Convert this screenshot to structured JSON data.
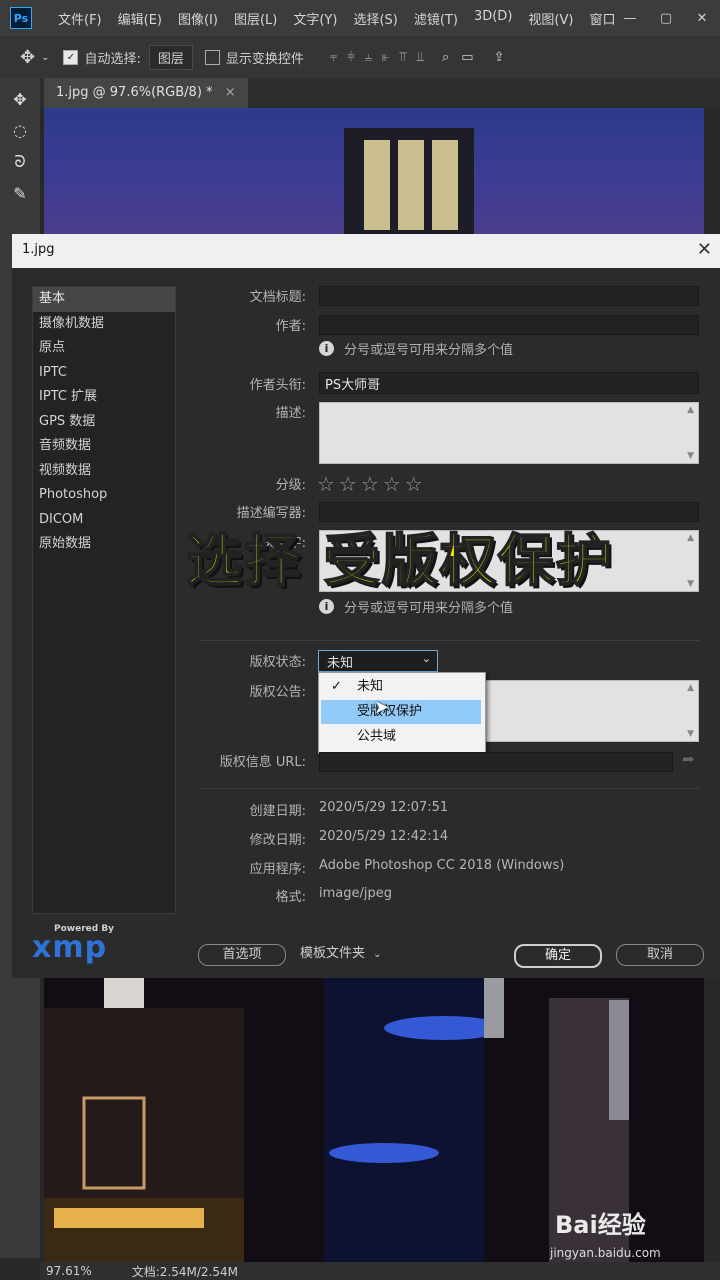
{
  "app": {
    "logo": "Ps"
  },
  "menubar": {
    "items": [
      "文件(F)",
      "编辑(E)",
      "图像(I)",
      "图层(L)",
      "文字(Y)",
      "选择(S)",
      "滤镜(T)",
      "3D(D)",
      "视图(V)",
      "窗口"
    ]
  },
  "optionsbar": {
    "auto_select_label": "自动选择:",
    "auto_select_value": "图层",
    "show_transform_label": "显示变换控件"
  },
  "document_tab": {
    "title": "1.jpg @ 97.6%(RGB/8) *"
  },
  "dialog": {
    "title": "1.jpg",
    "categories": [
      "基本",
      "摄像机数据",
      "原点",
      "IPTC",
      "IPTC 扩展",
      "GPS 数据",
      "音频数据",
      "视频数据",
      "Photoshop",
      "DICOM",
      "原始数据"
    ],
    "active_category": "基本",
    "fields": {
      "doc_title_label": "文档标题:",
      "author_label": "作者:",
      "multi_value_hint": "分号或逗号可用来分隔多个值",
      "author_title_label": "作者头衔:",
      "author_title_value": "PS大师哥",
      "description_label": "描述:",
      "rating_label": "分级:",
      "rating_stars": "☆☆☆☆☆",
      "desc_writer_label": "描述编写器:",
      "keywords_label": "关键字:",
      "keywords_hint": "分号或逗号可用来分隔多个值",
      "copyright_status_label": "版权状态:",
      "copyright_status_value": "未知",
      "copyright_notice_label": "版权公告:",
      "copyright_url_label": "版权信息 URL:",
      "created_label": "创建日期:",
      "created_value": "2020/5/29 12:07:51",
      "modified_label": "修改日期:",
      "modified_value": "2020/5/29 12:42:14",
      "application_label": "应用程序:",
      "application_value": "Adobe Photoshop CC 2018 (Windows)",
      "format_label": "格式:",
      "format_value": "image/jpeg"
    },
    "dropdown_options": [
      "未知",
      "受版权保护",
      "公共域"
    ],
    "xmp": {
      "powered_by": "Powered By",
      "logo": "xmp"
    },
    "buttons": {
      "preferences": "首选项",
      "templates": "模板文件夹",
      "ok": "确定",
      "cancel": "取消"
    }
  },
  "overlay_caption": "选择 受版权保护",
  "statusbar": {
    "zoom": "97.61%",
    "doc_size": "文档:2.54M/2.54M"
  },
  "watermark": {
    "brand": "Bai经验",
    "url": "jingyan.baidu.com"
  }
}
